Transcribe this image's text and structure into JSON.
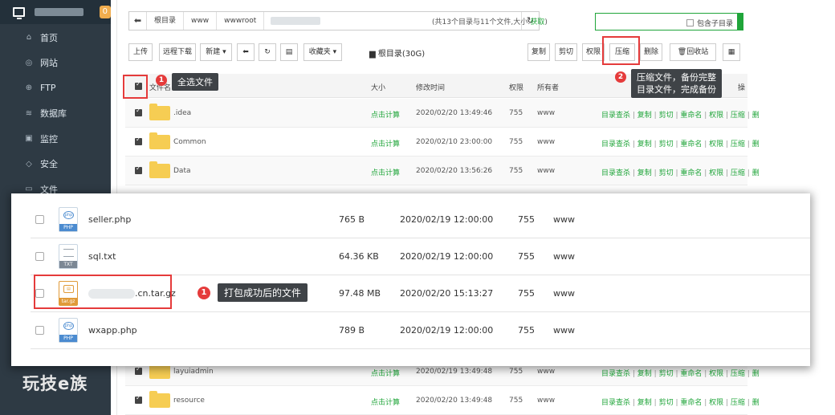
{
  "sidebar": {
    "badge_count": "0",
    "items": [
      {
        "icon": "home-icon",
        "glyph": "⌂",
        "label": "首页"
      },
      {
        "icon": "globe-icon",
        "glyph": "◎",
        "label": "网站"
      },
      {
        "icon": "ftp-icon",
        "glyph": "⊕",
        "label": "FTP"
      },
      {
        "icon": "database-icon",
        "glyph": "≋",
        "label": "数据库"
      },
      {
        "icon": "monitor-icon",
        "glyph": "▣",
        "label": "监控"
      },
      {
        "icon": "shield-icon",
        "glyph": "◇",
        "label": "安全"
      },
      {
        "icon": "folder-icon",
        "glyph": "▭",
        "label": "文件"
      }
    ],
    "brand": "玩技e族"
  },
  "pathbar": {
    "crumbs": [
      "根目录",
      "www",
      "wwwroot"
    ]
  },
  "count_info": {
    "text": "(共13个目录与11个文件,大小:",
    "link": "获取",
    "close": ")"
  },
  "search": {
    "checkbox_label": "包含子目录"
  },
  "toolbar": {
    "upload": "上传",
    "remote_download": "远程下载",
    "new": "新建 ▾",
    "favorites": "收藏夹 ▾",
    "disk": "根目录(30G)",
    "copy": "复制",
    "cut": "剪切",
    "permission": "权限",
    "compress": "压缩",
    "delete": "删除",
    "recycle": "回收站"
  },
  "table": {
    "headers": {
      "name": "文件名",
      "size": "大小",
      "mtime": "修改时间",
      "perm": "权限",
      "owner": "所有者",
      "op": "操"
    },
    "calc_label": "点击计算",
    "ops": [
      "目录查杀",
      "复制",
      "剪切",
      "重命名",
      "权限",
      "压缩",
      "删"
    ],
    "rows": [
      {
        "name": ".idea",
        "mtime": "2020/02/20 13:49:46",
        "perm": "755",
        "owner": "www"
      },
      {
        "name": "Common",
        "mtime": "2020/02/10 23:00:00",
        "perm": "755",
        "owner": "www"
      },
      {
        "name": "Data",
        "mtime": "2020/02/20 13:56:26",
        "perm": "755",
        "owner": "www"
      }
    ],
    "bottom_rows": [
      {
        "name": "layuiadmin",
        "mtime": "2020/02/19 13:49:48",
        "perm": "755",
        "owner": "www"
      },
      {
        "name": "resource",
        "mtime": "2020/02/20 13:49:48",
        "perm": "755",
        "owner": "www"
      }
    ]
  },
  "overlay": {
    "rows": [
      {
        "icon": "php-file-icon",
        "type": "PHP",
        "name": "seller.php",
        "size": "765 B",
        "mtime": "2020/02/19 12:00:00",
        "perm": "755",
        "owner": "www"
      },
      {
        "icon": "txt-file-icon",
        "type": "TXT",
        "name": "sql.txt",
        "size": "64.36 KB",
        "mtime": "2020/02/19 12:00:00",
        "perm": "755",
        "owner": "www"
      },
      {
        "icon": "archive-file-icon",
        "type": "tar.gz",
        "name": ".cn.tar.gz",
        "size": "97.48 MB",
        "mtime": "2020/02/20 15:13:27",
        "perm": "755",
        "owner": "www"
      },
      {
        "icon": "php-file-icon",
        "type": "PHP",
        "name": "wxapp.php",
        "size": "789 B",
        "mtime": "2020/02/19 12:00:00",
        "perm": "755",
        "owner": "www"
      }
    ]
  },
  "annotations": {
    "select_all_num": "1",
    "select_all_tip": "全选文件",
    "compress_num": "2",
    "compress_tip": "压缩文件，备份完整\n目录文件，完成备份",
    "packed_num": "1",
    "packed_tip": "打包成功后的文件"
  },
  "colors": {
    "accent": "#20a53a",
    "annotation": "#e53b3b",
    "sidebar": "#2e3a44"
  }
}
